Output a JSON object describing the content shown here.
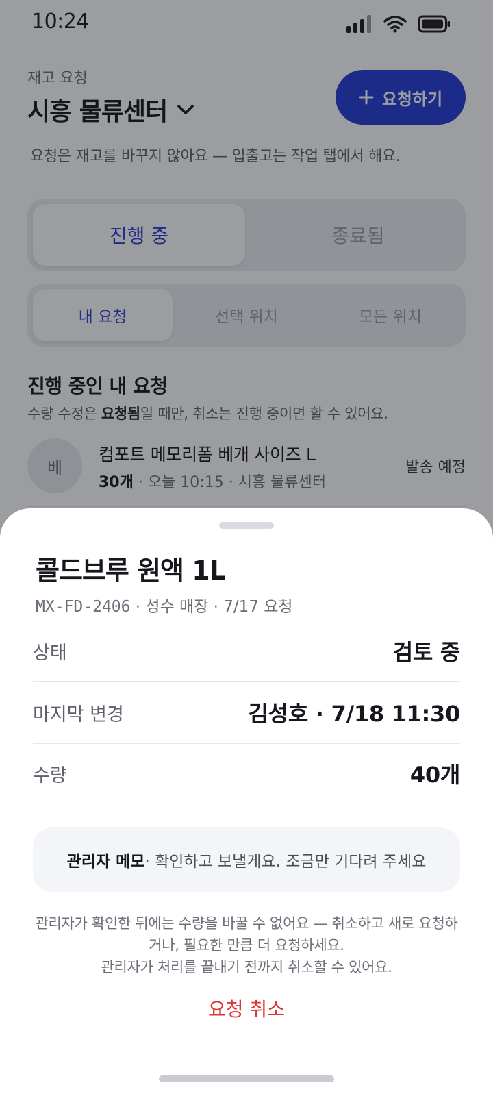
{
  "status_bar": {
    "time": "10:24"
  },
  "header": {
    "eyebrow": "재고 요청",
    "location": "시흥 물류센터",
    "request_button": "요청하기",
    "helper": "요청은 재고를 바꾸지 않아요 — 입출고는 작업 탭에서 해요."
  },
  "tabs": {
    "active": "진행 중",
    "inactive": "종료됨"
  },
  "scope_tabs": [
    "내 요청",
    "선택 위치",
    "모든 위치"
  ],
  "section": {
    "title": "진행 중인 내 요청",
    "sub_bold": "요청됨",
    "sub_prefix": "수량 수정은 ",
    "sub_suffix": "일 때만, 취소는 진행 중이면 할 수 있어요."
  },
  "list": [
    {
      "avatar": "베",
      "name": "컴포트 메모리폼 베개 사이즈 L",
      "qty": "30개",
      "meta": " · 오늘 10:15 · 시흥 물류센터",
      "status": "발송 예정"
    }
  ],
  "sheet": {
    "title": "콜드브루 원액 1L",
    "code": "MX-FD-2406",
    "sub_rest": " · 성수 매장 · 7/17 요청",
    "rows": [
      {
        "label": "상태",
        "value": "검토 중"
      },
      {
        "label": "마지막 변경",
        "value": "김성호 · 7/18 11:30"
      },
      {
        "label": "수량",
        "value": "40개"
      }
    ],
    "memo_label": "관리자 메모",
    "memo_text": " · 확인하고 보낼게요. 조금만 기다려 주세요",
    "notice_line1": "관리자가 확인한 뒤에는 수량을 바꿀 수 없어요 — 취소하고 새로 요청하거나, 필요한 만큼 더 요청하세요.",
    "notice_line2": "관리자가 처리를 끝내기 전까지 취소할 수 있어요.",
    "cancel": "요청 취소"
  },
  "colors": {
    "primary": "#2439d6",
    "danger": "#e03434"
  }
}
